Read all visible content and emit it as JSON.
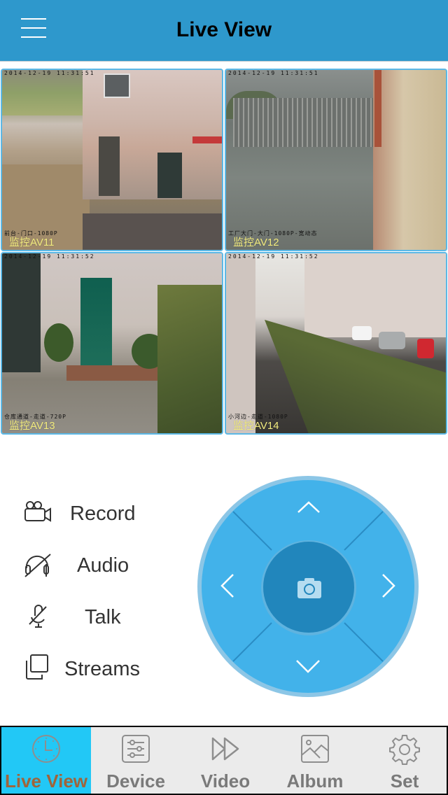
{
  "header": {
    "title": "Live View",
    "menu_icon": "hamburger-menu-icon",
    "background": "#2e98cc"
  },
  "cameras": [
    {
      "label": "监控AV11",
      "timestamp": "2014-12-19 11:31:51",
      "info": "前台-门口-1080P"
    },
    {
      "label": "监控AV12",
      "timestamp": "2014-12-19 11:31:51",
      "info": "工厂大门-大门-1080P-宽动态"
    },
    {
      "label": "监控AV13",
      "timestamp": "2014-12-19 11:31:52",
      "info": "仓库通道-走道-720P"
    },
    {
      "label": "监控AV14",
      "timestamp": "2014-12-19 11:31:52",
      "info": "小河边-走道-1080P"
    }
  ],
  "controls": [
    {
      "label": "Record",
      "icon": "video-camera-icon"
    },
    {
      "label": "Audio",
      "icon": "headphones-muted-icon"
    },
    {
      "label": "Talk",
      "icon": "microphone-muted-icon"
    },
    {
      "label": "Streams",
      "icon": "stacked-windows-icon"
    }
  ],
  "ptz": {
    "up_icon": "chevron-up-icon",
    "down_icon": "chevron-down-icon",
    "left_icon": "chevron-left-icon",
    "right_icon": "chevron-right-icon",
    "center_icon": "camera-snapshot-icon",
    "colors": {
      "ring": "#8cc6e6",
      "pad": "#42b2ea",
      "center": "#2186bc",
      "divider": "#2a8cc4"
    }
  },
  "tabbar": {
    "active_color": "#22c8f6",
    "active_text_color": "#a0643a",
    "tabs": [
      {
        "label": "Live View",
        "icon": "clock-icon",
        "active": true
      },
      {
        "label": "Device",
        "icon": "sliders-icon",
        "active": false
      },
      {
        "label": "Video",
        "icon": "fast-forward-icon",
        "active": false
      },
      {
        "label": "Album",
        "icon": "image-icon",
        "active": false
      },
      {
        "label": "Set",
        "icon": "gear-icon",
        "active": false
      }
    ]
  }
}
